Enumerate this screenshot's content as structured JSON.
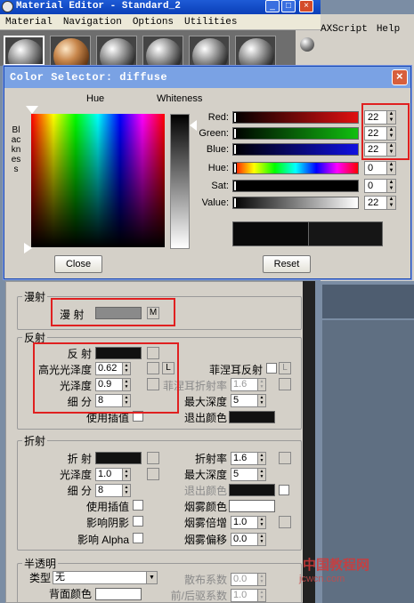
{
  "material_editor": {
    "title": "Material Editor - Standard_2",
    "window_buttons": [
      "_",
      "□",
      "×"
    ],
    "menu": [
      "Material",
      "Navigation",
      "Options",
      "Utilities"
    ]
  },
  "maxscript_menu": [
    "AXScript",
    "Help"
  ],
  "color_selector": {
    "title": "Color Selector: diffuse",
    "hue_label": "Hue",
    "whiteness_label": "Whiteness",
    "blackness_label": "Blackness",
    "close_button": "Close",
    "reset_button": "Reset",
    "close_x": "×",
    "sliders": [
      {
        "label": "Red:",
        "value": "22",
        "color": "#e01010"
      },
      {
        "label": "Green:",
        "value": "22",
        "color": "#10c010"
      },
      {
        "label": "Blue:",
        "value": "22",
        "color": "#1010e0"
      },
      {
        "label": "Hue:",
        "value": "0",
        "color": "hue"
      },
      {
        "label": "Sat:",
        "value": "0",
        "color": "#000000"
      },
      {
        "label": "Value:",
        "value": "22",
        "color": "#ffffff"
      }
    ]
  },
  "diffuse_group": {
    "title": "漫射",
    "label": "漫 射",
    "map_button": "M"
  },
  "reflection_group": {
    "title": "反射",
    "reflect": "反 射",
    "gloss_label": "高光光泽度",
    "gloss": "0.62",
    "refl_gloss_label": "光泽度",
    "refl_gloss": "0.9",
    "subdivs_label": "细 分",
    "subdivs": "8",
    "interp_label": "使用插值",
    "fresnel_label": "菲涅耳反射",
    "fresnel_ior_label": "菲涅耳折射率",
    "fresnel_ior": "1.6",
    "max_depth_label": "最大深度",
    "max_depth": "5",
    "exit_color_label": "退出颜色",
    "lock_button": "L"
  },
  "refraction_group": {
    "title": "折射",
    "refract": "折 射",
    "gloss_label": "光泽度",
    "gloss": "1.0",
    "subdivs_label": "细 分",
    "subdivs": "8",
    "interp_label": "使用插值",
    "shadows_label": "影响阴影",
    "affect_alpha_label": "影响 Alpha",
    "ior_label": "折射率",
    "ior": "1.6",
    "max_depth_label": "最大深度",
    "max_depth": "5",
    "exit_color_label": "退出颜色",
    "fog_color_label": "烟雾颜色",
    "fog_mult_label": "烟雾倍增",
    "fog_mult": "1.0",
    "fog_bias_label": "烟雾偏移",
    "fog_bias": "0.0"
  },
  "translucency_group": {
    "title": "半透明",
    "type_label": "类型",
    "type_value": "无",
    "back_color_label": "背面颜色",
    "scatter_label": "散布系数",
    "scatter": "0.0",
    "fb_label": "前/后驱系数",
    "fb": "1.0"
  },
  "watermark": {
    "line1": "中国教程网",
    "line2": "jcwcn.com"
  }
}
